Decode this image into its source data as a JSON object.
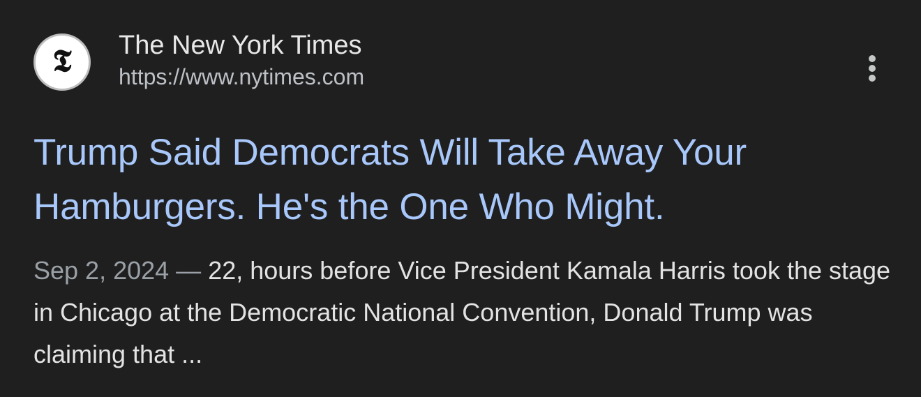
{
  "result": {
    "source_name": "The New York Times",
    "source_url": "https://www.nytimes.com",
    "favicon_glyph": "𝕿",
    "favicon_icon": "nyt-logo-icon",
    "more_icon": "more-vert-icon",
    "headline": "Trump Said Democrats Will Take Away Your Hamburgers. He's the One Who Might.",
    "date": "Sep 2, 2024",
    "separator": " — ",
    "snippet": "22, hours before Vice President Kamala Harris took the stage in Chicago at the Democratic National Convention, Donald Trump was claiming that ..."
  },
  "colors": {
    "background": "#1f1f1f",
    "headline_link": "#a8c7fa",
    "primary_text": "#e3e3e3",
    "secondary_text": "#9aa0a6"
  }
}
